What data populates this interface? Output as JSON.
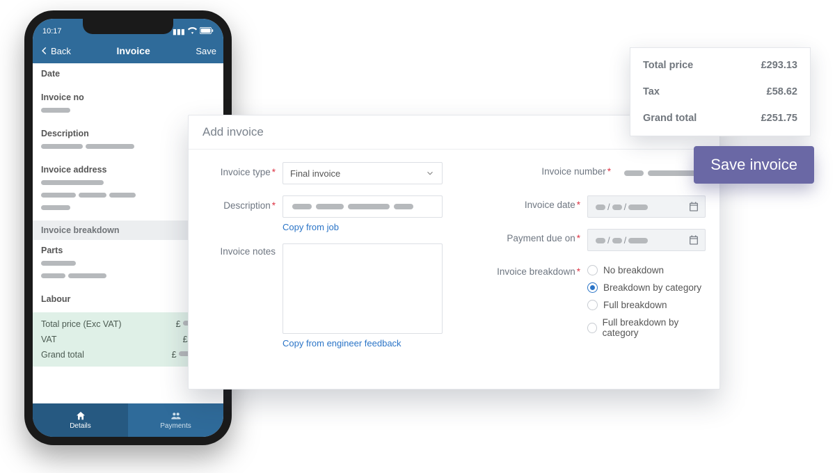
{
  "phone": {
    "time": "10:17",
    "back": "Back",
    "title": "Invoice",
    "save": "Save",
    "fields": {
      "date": "Date",
      "invoice_no": "Invoice no",
      "description": "Description",
      "invoice_address": "Invoice address",
      "breakdown": "Invoice breakdown",
      "parts": "Parts",
      "labour": "Labour"
    },
    "totals": {
      "total_price_label": "Total price (Exc VAT)",
      "total_price_val": "£",
      "vat_label": "VAT",
      "vat_val": "£",
      "grand_label": "Grand total",
      "grand_val": "£"
    },
    "tabs": {
      "details": "Details",
      "payments": "Payments"
    }
  },
  "panel": {
    "title": "Add invoice",
    "left": {
      "invoice_type": "Invoice type",
      "invoice_type_value": "Final invoice",
      "description": "Description",
      "copy_from_job": "Copy from job",
      "invoice_notes": "Invoice notes",
      "copy_from_feedback": "Copy from engineer feedback"
    },
    "right": {
      "invoice_number": "Invoice number",
      "invoice_date": "Invoice date",
      "payment_due": "Payment due on",
      "breakdown": "Invoice breakdown",
      "options": {
        "none": "No breakdown",
        "category": "Breakdown by category",
        "full": "Full breakdown",
        "full_category": "Full breakdown by category"
      }
    }
  },
  "totals_card": {
    "total_price_k": "Total price",
    "total_price_v": "£293.13",
    "tax_k": "Tax",
    "tax_v": "£58.62",
    "grand_k": "Grand total",
    "grand_v": "£251.75"
  },
  "save_invoice": "Save invoice"
}
